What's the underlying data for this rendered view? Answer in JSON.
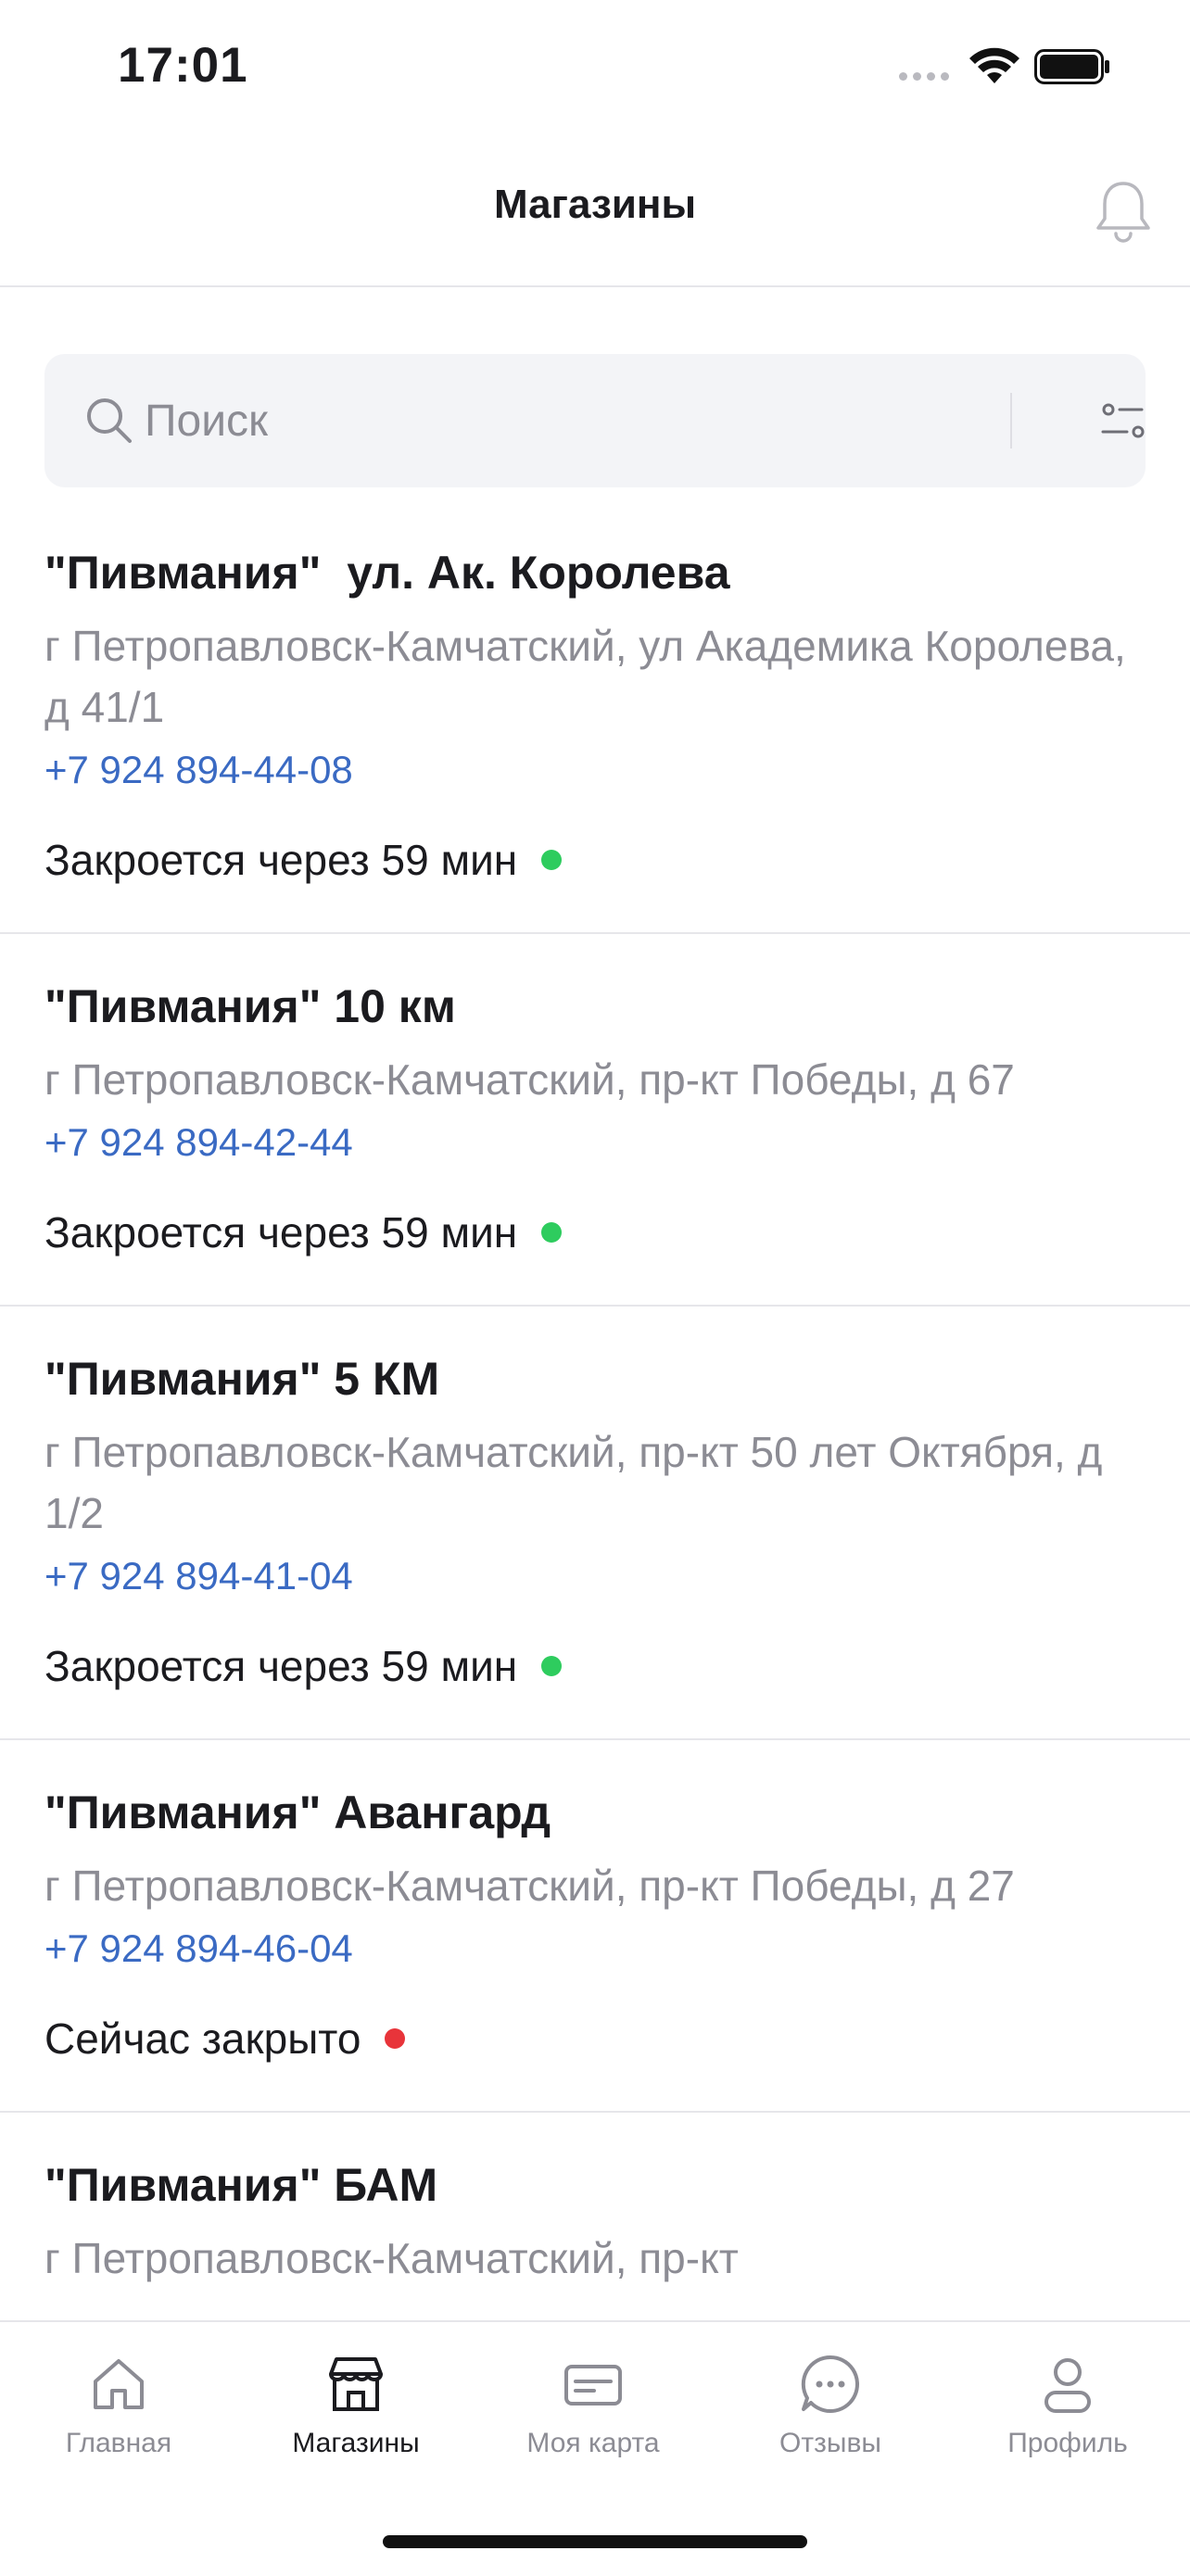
{
  "status_bar": {
    "time": "17:01"
  },
  "header": {
    "title": "Магазины"
  },
  "search": {
    "placeholder": "Поиск"
  },
  "stores": [
    {
      "name": "\"Пивмания\"  ул. Ак. Королева",
      "address": "г Петропавловск-Камчатский, ул Академика Королева, д 41/1",
      "phone": "+7 924 894-44-08",
      "status": "Закроется через 59 мин",
      "status_color": "#2ecc5e"
    },
    {
      "name": "\"Пивмания\" 10 км",
      "address": "г Петропавловск-Камчатский, пр-кт Победы, д 67",
      "phone": "+7 924 894-42-44",
      "status": "Закроется через 59 мин",
      "status_color": "#2ecc5e"
    },
    {
      "name": "\"Пивмания\" 5 КМ",
      "address": "г Петропавловск-Камчатский, пр-кт 50 лет Октября, д 1/2",
      "phone": "+7 924 894-41-04",
      "status": "Закроется через 59 мин",
      "status_color": "#2ecc5e"
    },
    {
      "name": "\"Пивмания\" Авангард",
      "address": "г Петропавловск-Камчатский, пр-кт Победы, д 27",
      "phone": "+7 924 894-46-04",
      "status": "Сейчас закрыто",
      "status_color": "#e8343a"
    },
    {
      "name": "\"Пивмания\" БАМ",
      "address": "г Петропавловск-Камчатский, пр-кт",
      "phone": "",
      "status": "",
      "status_color": ""
    }
  ],
  "tab_bar": {
    "tabs": [
      {
        "label": "Главная",
        "icon": "home-icon",
        "active": false
      },
      {
        "label": "Магазины",
        "icon": "store-icon",
        "active": true
      },
      {
        "label": "Моя карта",
        "icon": "card-icon",
        "active": false
      },
      {
        "label": "Отзывы",
        "icon": "chat-icon",
        "active": false
      },
      {
        "label": "Профиль",
        "icon": "profile-icon",
        "active": false
      }
    ]
  },
  "colors": {
    "phone": "#3a6ac3",
    "open": "#2ecc5e",
    "closed": "#e8343a",
    "muted": "#8c8c94"
  }
}
